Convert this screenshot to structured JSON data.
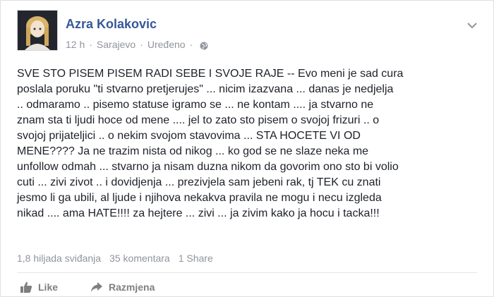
{
  "post": {
    "author": "Azra Kolakovic",
    "time": "12 h",
    "location": "Sarajevo",
    "edited": "Uređeno",
    "privacy_icon": "globe-icon",
    "text": "SVE STO PISEM PISEM RADI SEBE I SVOJE RAJE -- Evo meni je sad cura\nposlala poruku \"ti stvarno pretjerujes\" ... nicim izazvana ... danas je nedjelja\n.. odmaramo .. pisemo statuse igramo se ... ne kontam .... ja stvarno ne\nznam sta ti ljudi hoce od mene .... jel to zato sto pisem o svojoj frizuri .. o\nsvojoj prijateljici .. o nekim svojom stavovima ... STA HOCETE VI OD\nMENE???? Ja ne trazim nista od nikog ... ko god se ne slaze neka me\nunfollow odmah ... stvarno ja nisam duzna nikom da govorim ono sto bi volio\ncuti ... zivi zivot .. i dovidjenja ... prezivjela sam jebeni rak, tj TEK cu znati\njesmo li ga ubili, al ljude i njihova nekakva pravila ne mogu i necu izgleda\nnikad .... ama HATE!!!! za hejtere ... zivi ... ja zivim kako ja hocu i tacka!!!"
  },
  "stats": {
    "likes": "1,8 hiljada sviđanja",
    "comments": "35 komentara",
    "shares": "1 Share"
  },
  "actions": {
    "like_label": "Like",
    "share_label": "Razmjena"
  },
  "colors": {
    "author_link": "#365899",
    "meta_gray": "#90949c",
    "text": "#1d2129"
  }
}
